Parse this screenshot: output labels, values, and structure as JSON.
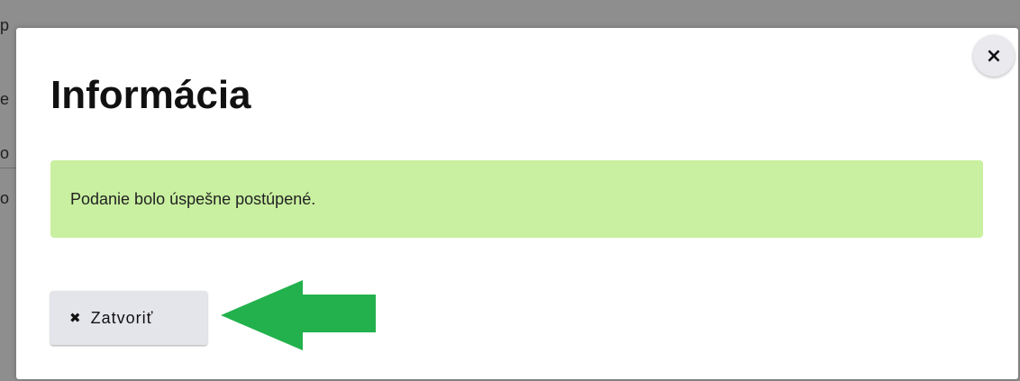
{
  "dialog": {
    "title": "Informácia",
    "close_icon": "×",
    "message": "Podanie bolo úspešne postúpené.",
    "close_button": {
      "icon": "✖",
      "label": "Zatvoriť"
    }
  },
  "colors": {
    "alert_bg": "#c8f0a0",
    "arrow": "#22b14c",
    "overlay": "#8e8e8e"
  }
}
